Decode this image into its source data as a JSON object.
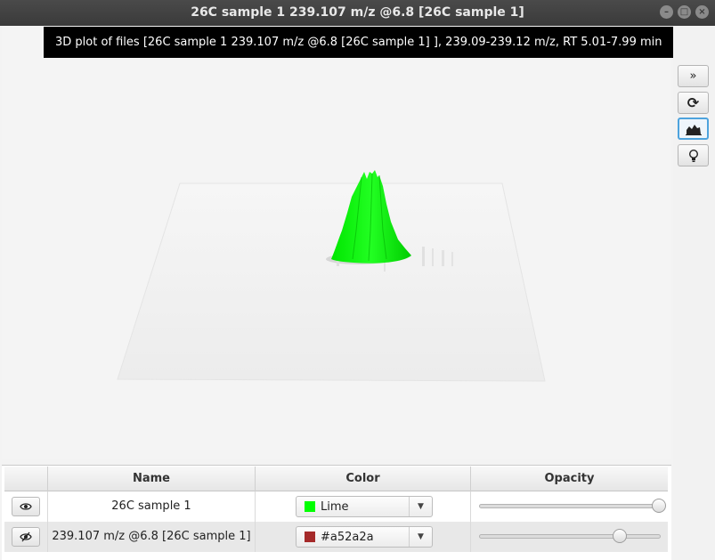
{
  "window": {
    "title": "26C sample 1 239.107 m/z @6.8 [26C sample 1]",
    "controls": {
      "minimize": "–",
      "maximize": "□",
      "close": "×"
    }
  },
  "plot": {
    "caption": "3D plot of files [26C sample 1 239.107 m/z @6.8 [26C sample 1] ], 239.09-239.12 m/z, RT 5.01-7.99 min",
    "surface_color": "#00ff00"
  },
  "toolbar": {
    "buttons": [
      {
        "name": "expand",
        "icon": "double-chevron-right-icon",
        "glyph": "»"
      },
      {
        "name": "refresh",
        "icon": "refresh-icon",
        "glyph": "⟳"
      },
      {
        "name": "peak",
        "icon": "area-chart-icon",
        "active": true
      },
      {
        "name": "light",
        "icon": "lightbulb-icon"
      }
    ]
  },
  "table": {
    "headers": [
      "",
      "Name",
      "Color",
      "Opacity"
    ],
    "rows": [
      {
        "visible_icon": "eye-icon",
        "name": "26C sample 1",
        "color_label": "Lime",
        "color_hex": "#00ff00",
        "opacity": 1.0
      },
      {
        "visible_icon": "eye-slash-icon",
        "name": "239.107 m/z @6.8 [26C sample 1]",
        "color_label": "#a52a2a",
        "color_hex": "#a52a2a",
        "opacity": 0.78
      }
    ]
  }
}
